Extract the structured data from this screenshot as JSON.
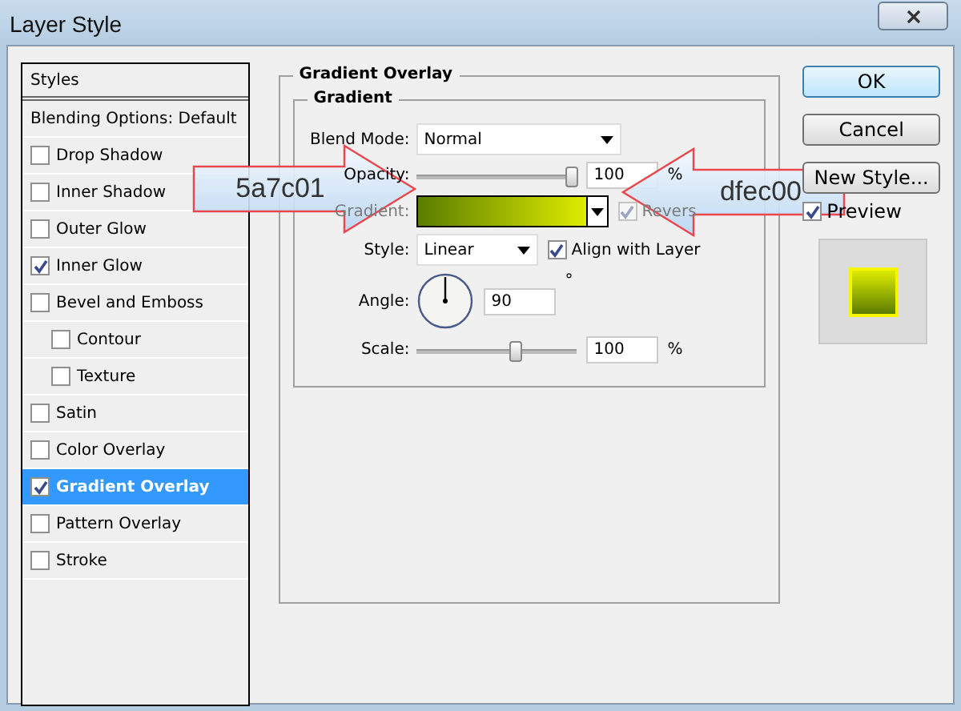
{
  "window": {
    "title": "Layer Style"
  },
  "sidebar": {
    "header": "Styles",
    "items": [
      {
        "label": "Blending Options: Default",
        "kind": "plain",
        "selected": false
      },
      {
        "label": "Drop Shadow",
        "kind": "check",
        "checked": false,
        "selected": false
      },
      {
        "label": "Inner Shadow",
        "kind": "check",
        "checked": false,
        "selected": false
      },
      {
        "label": "Outer Glow",
        "kind": "check",
        "checked": false,
        "selected": false
      },
      {
        "label": "Inner Glow",
        "kind": "check",
        "checked": true,
        "selected": false
      },
      {
        "label": "Bevel and Emboss",
        "kind": "check",
        "checked": false,
        "selected": false,
        "children": [
          {
            "label": "Contour",
            "kind": "check",
            "checked": false,
            "selected": false
          },
          {
            "label": "Texture",
            "kind": "check",
            "checked": false,
            "selected": false
          }
        ]
      },
      {
        "label": "Satin",
        "kind": "check",
        "checked": false,
        "selected": false
      },
      {
        "label": "Color Overlay",
        "kind": "check",
        "checked": false,
        "selected": false
      },
      {
        "label": "Gradient Overlay",
        "kind": "check",
        "checked": true,
        "selected": true
      },
      {
        "label": "Pattern Overlay",
        "kind": "check",
        "checked": false,
        "selected": false
      },
      {
        "label": "Stroke",
        "kind": "check",
        "checked": false,
        "selected": false
      }
    ]
  },
  "panel": {
    "title": "Gradient Overlay",
    "group_title": "Gradient",
    "blend_mode": {
      "label": "Blend Mode:",
      "value": "Normal"
    },
    "opacity": {
      "label": "Opacity:",
      "level": 0.97,
      "value": "100",
      "unit": "%"
    },
    "gradient": {
      "label": "Gradient:",
      "stops": [
        {
          "color": "#5a7c01"
        },
        {
          "color": "#dfec00"
        }
      ]
    },
    "reverse": {
      "label": "Revers",
      "checked": true,
      "disabled": true
    },
    "style": {
      "label": "Style:",
      "value": "Linear"
    },
    "align_with_layer": {
      "label": "Align with Layer",
      "checked": true
    },
    "angle": {
      "label": "Angle:",
      "value": "90",
      "unit": "°"
    },
    "scale": {
      "label": "Scale:",
      "level": 0.62,
      "value": "100",
      "unit": "%"
    }
  },
  "buttons": [
    {
      "label": "OK",
      "default": true
    },
    {
      "label": "Cancel",
      "default": false
    },
    {
      "label": "New Style...",
      "default": false
    }
  ],
  "preview": {
    "label": "Preview",
    "checked": true
  },
  "callouts": [
    {
      "text": "5a7c01",
      "kind": "right-arrow"
    },
    {
      "text": "dfec00",
      "kind": "left-arrow"
    }
  ]
}
